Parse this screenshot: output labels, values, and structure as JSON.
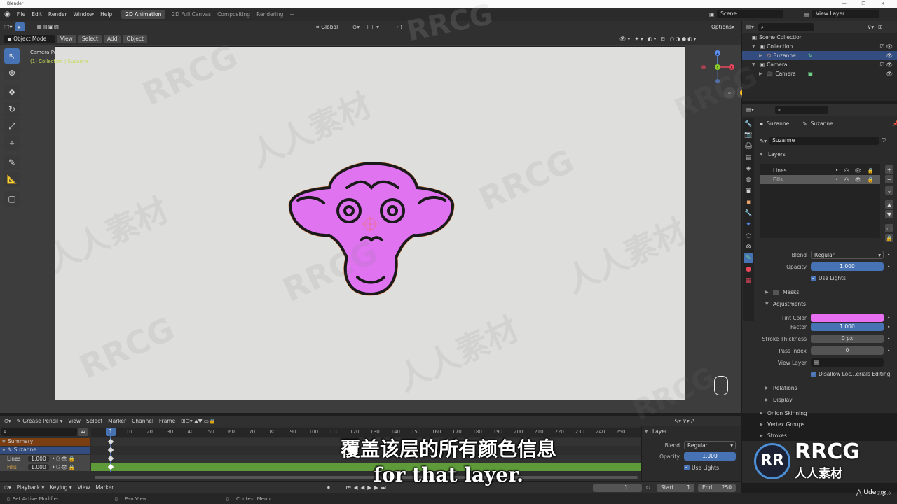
{
  "titlebar": {
    "title": "Blender"
  },
  "menubar": {
    "menus": [
      "File",
      "Edit",
      "Render",
      "Window",
      "Help"
    ],
    "workspaces": [
      "2D Animation",
      "2D Full Canvas",
      "Compositing",
      "Rendering"
    ],
    "add": "+",
    "scene": "Scene",
    "view_layer": "View Layer"
  },
  "header": {
    "mode": "Object Mode",
    "menus": [
      "View",
      "Select",
      "Add",
      "Object"
    ],
    "transform": "Global",
    "options": "Options"
  },
  "viewport": {
    "info_line1": "Camera Perspective",
    "info_line2": "(1) Collection | Suzanne"
  },
  "outliner": {
    "items": [
      {
        "label": "Scene Collection"
      },
      {
        "label": "Collection"
      },
      {
        "label": "Suzanne"
      },
      {
        "label": "Camera"
      },
      {
        "label": "Camera"
      }
    ]
  },
  "properties": {
    "breadcrumb_object": "Suzanne",
    "breadcrumb_data": "Suzanne",
    "datablock": "Suzanne",
    "layers_title": "Layers",
    "layers": [
      "Lines",
      "Fills"
    ],
    "blend_label": "Blend",
    "blend_value": "Regular",
    "opacity_label": "Opacity",
    "opacity_value": "1.000",
    "use_lights": "Use Lights",
    "masks": "Masks",
    "adjustments": "Adjustments",
    "tint_color_label": "Tint Color",
    "factor_label": "Factor",
    "factor_value": "1.000",
    "stroke_thickness_label": "Stroke Thickness",
    "stroke_thickness_value": "0 px",
    "pass_index_label": "Pass Index",
    "pass_index_value": "0",
    "view_layer_label": "View Layer",
    "disallow_label": "Disallow Loc...erials Editing",
    "relations": "Relations",
    "display": "Display",
    "onion": "Onion Skinning",
    "vertex_groups": "Vertex Groups",
    "strokes": "Strokes"
  },
  "timeline": {
    "editor": "Grease Pencil",
    "menus": [
      "View",
      "Select",
      "Marker",
      "Channel",
      "Frame"
    ],
    "ticks": [
      "1",
      "10",
      "20",
      "30",
      "40",
      "50",
      "60",
      "70",
      "80",
      "90",
      "100",
      "110",
      "120",
      "130",
      "140",
      "150",
      "160",
      "170",
      "180",
      "190",
      "200",
      "210",
      "220",
      "230",
      "240",
      "250"
    ],
    "channels": [
      {
        "label": "Summary"
      },
      {
        "label": "Suzanne"
      },
      {
        "label": "Lines",
        "value": "1.000"
      },
      {
        "label": "Fills",
        "value": "1.000"
      }
    ],
    "panel_title": "Layer",
    "panel_blend_label": "Blend",
    "panel_blend_value": "Regular",
    "panel_opacity_label": "Opacity",
    "panel_opacity_value": "1.000",
    "panel_use_lights": "Use Lights",
    "playback": "Playback",
    "keying": "Keying",
    "view": "View",
    "marker": "Marker",
    "current_frame": "1",
    "start_label": "Start",
    "start_value": "1",
    "end_label": "End",
    "end_value": "250"
  },
  "statusbar": {
    "left": "Set Active Modifier",
    "middle": "Pan View",
    "right": "Context Menu",
    "version": "2.92.0"
  },
  "subtitle": {
    "zh": "覆盖该层的所有颜色信息",
    "en": "for that layer."
  },
  "watermark": {
    "brand": "RRCG",
    "brand_sub": "人人素材",
    "udemy": "Udemy"
  },
  "colors": {
    "accent": "#4772b3",
    "tint": "#e86ef2",
    "monkey_fill": "#df73f0",
    "viewport_bg": "#dededd",
    "channel_green": "#5e9a3a",
    "summary_orange": "#7a3e12"
  }
}
